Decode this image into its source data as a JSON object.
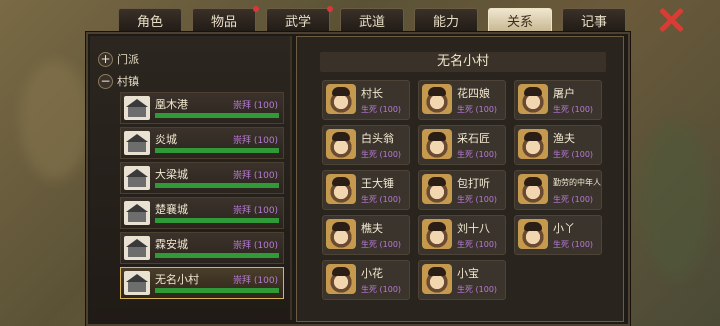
{
  "tabs": [
    {
      "label": "角色",
      "active": false,
      "badge": false
    },
    {
      "label": "物品",
      "active": false,
      "badge": true
    },
    {
      "label": "武学",
      "active": false,
      "badge": true
    },
    {
      "label": "武道",
      "active": false,
      "badge": false
    },
    {
      "label": "能力",
      "active": false,
      "badge": false
    },
    {
      "label": "关系",
      "active": true,
      "badge": false
    },
    {
      "label": "记事",
      "active": false,
      "badge": false
    }
  ],
  "groups": {
    "sect": "门派",
    "village": "村镇"
  },
  "villages": [
    {
      "name": "凰木港",
      "rank": "崇拜 (100)",
      "progress": 1.0,
      "selected": false
    },
    {
      "name": "炎城",
      "rank": "崇拜 (100)",
      "progress": 1.0,
      "selected": false
    },
    {
      "name": "大梁城",
      "rank": "崇拜 (100)",
      "progress": 1.0,
      "selected": false
    },
    {
      "name": "楚襄城",
      "rank": "崇拜 (100)",
      "progress": 1.0,
      "selected": false
    },
    {
      "name": "霖安城",
      "rank": "崇拜 (100)",
      "progress": 1.0,
      "selected": false
    },
    {
      "name": "无名小村",
      "rank": "崇拜 (100)",
      "progress": 1.0,
      "selected": true
    }
  ],
  "panel_title": "无名小村",
  "npcs": [
    {
      "name": "村长",
      "stat": "生死 (100)"
    },
    {
      "name": "花四娘",
      "stat": "生死 (100)"
    },
    {
      "name": "屠户",
      "stat": "生死 (100)"
    },
    {
      "name": "白头翁",
      "stat": "生死 (100)"
    },
    {
      "name": "采石匠",
      "stat": "生死 (100)"
    },
    {
      "name": "渔夫",
      "stat": "生死 (100)"
    },
    {
      "name": "王大锤",
      "stat": "生死 (100)"
    },
    {
      "name": "包打听",
      "stat": "生死 (100)"
    },
    {
      "name": "勤劳的中年人",
      "stat": "生死 (100)"
    },
    {
      "name": "樵夫",
      "stat": "生死 (100)"
    },
    {
      "name": "刘十八",
      "stat": "生死 (100)"
    },
    {
      "name": "小丫",
      "stat": "生死 (100)"
    },
    {
      "name": "小花",
      "stat": "生死 (100)"
    },
    {
      "name": "小宝",
      "stat": "生死 (100)"
    }
  ],
  "colors": {
    "accent": "#d9b45a",
    "bar": "#2f9a37",
    "rank": "#b87ad8",
    "close": "#d83c33"
  }
}
